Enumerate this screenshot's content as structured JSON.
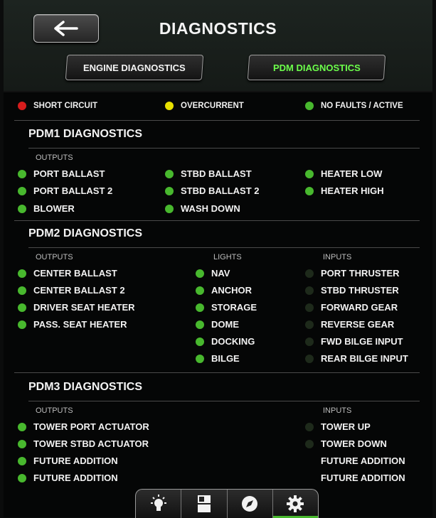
{
  "header": {
    "title": "DIAGNOSTICS",
    "tabs": [
      "ENGINE DIAGNOSTICS",
      "PDM DIAGNOSTICS"
    ],
    "active_tab": "PDM DIAGNOSTICS",
    "back_icon": "arrow-left-icon"
  },
  "legend": {
    "short_circuit": "SHORT CIRCUIT",
    "overcurrent": "OVERCURRENT",
    "no_faults": "NO FAULTS / ACTIVE",
    "colors": {
      "red": "#d61c1c",
      "yellow": "#e8e000",
      "green": "#48b82e",
      "inactive": "#1e2a1b"
    }
  },
  "pdm1": {
    "title": "PDM1 DIAGNOSTICS",
    "outputs_label": "OUTPUTS",
    "col1": [
      "PORT BALLAST",
      "PORT BALLAST 2",
      "BLOWER"
    ],
    "col2": [
      "STBD BALLAST",
      "STBD BALLAST 2",
      "WASH DOWN"
    ],
    "col3": [
      "HEATER LOW",
      "HEATER HIGH"
    ]
  },
  "pdm2": {
    "title": "PDM2 DIAGNOSTICS",
    "outputs_label": "OUTPUTS",
    "lights_label": "LIGHTS",
    "inputs_label": "INPUTS",
    "outputs": [
      "CENTER BALLAST",
      "CENTER BALLAST 2",
      "DRIVER SEAT HEATER",
      "PASS. SEAT HEATER"
    ],
    "lights": [
      "NAV",
      "ANCHOR",
      "STORAGE",
      "DOME",
      "DOCKING",
      "BILGE"
    ],
    "inputs": [
      "PORT THRUSTER",
      "STBD THRUSTER",
      "FORWARD GEAR",
      "REVERSE GEAR",
      "FWD BILGE INPUT",
      "REAR BILGE INPUT"
    ]
  },
  "pdm3": {
    "title": "PDM3 DIAGNOSTICS",
    "outputs_label": "OUTPUTS",
    "inputs_label": "INPUTS",
    "outputs": [
      "TOWER PORT ACTUATOR",
      "TOWER STBD ACTUATOR",
      "FUTURE ADDITION",
      "FUTURE ADDITION"
    ],
    "inputs": [
      "TOWER UP",
      "TOWER DOWN",
      "FUTURE ADDITION",
      "FUTURE ADDITION"
    ]
  },
  "navbar": {
    "icons": [
      "lightbulb-icon",
      "panels-icon",
      "compass-icon",
      "gear-icon"
    ],
    "active": "gear-icon"
  }
}
